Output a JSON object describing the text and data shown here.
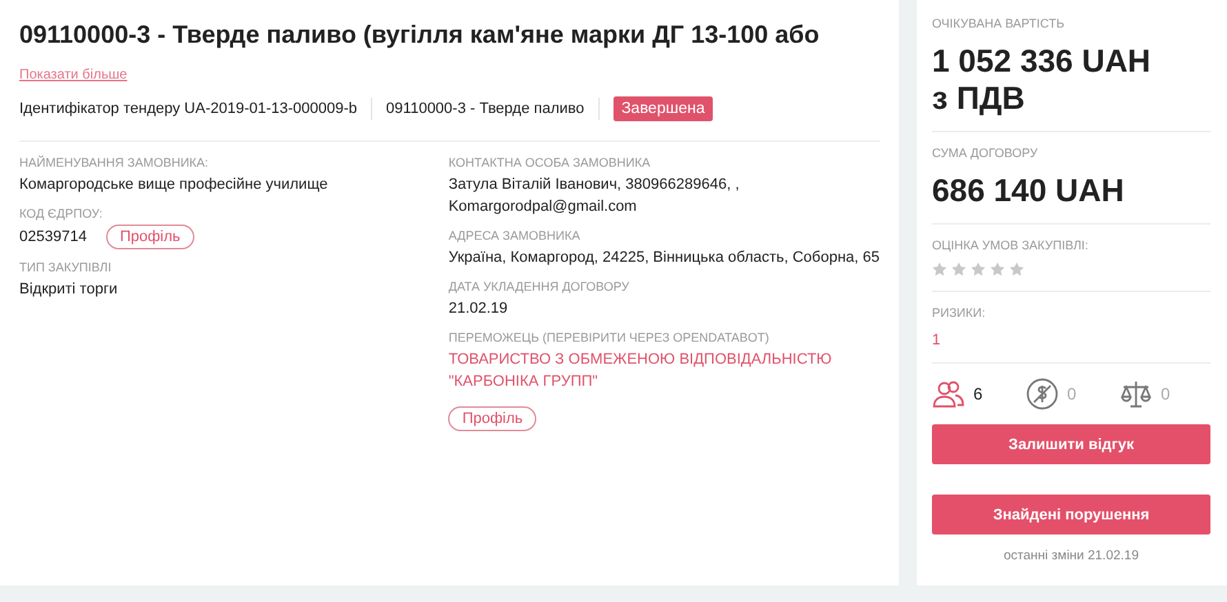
{
  "title": "09110000-3 - Тверде паливо (вугілля кам'яне марки ДГ 13-100 або",
  "show_more": "Показати більше",
  "meta": {
    "tender_id": "Ідентифікатор тендеру UA-2019-01-13-000009-b",
    "classification": "09110000-3 - Тверде паливо",
    "status": "Завершена"
  },
  "left_fields": [
    {
      "label": "НАЙМЕНУВАННЯ ЗАМОВНИКА:",
      "value": "Комаргородське вище професійне училище",
      "kind": "text"
    },
    {
      "label": "КОД ЄДРПОУ:",
      "value": "02539714",
      "kind": "profile",
      "button": "Профіль"
    },
    {
      "label": "ТИП ЗАКУПІВЛІ",
      "value": "Відкриті торги",
      "kind": "text"
    }
  ],
  "right_fields": [
    {
      "label": "КОНТАКТНА ОСОБА ЗАМОВНИКА",
      "lines": [
        "Затула Віталій Іванович, 380966289646, ,",
        "Komargorodpal@gmail.com"
      ],
      "kind": "text"
    },
    {
      "label": "АДРЕСА ЗАМОВНИКА",
      "lines": [
        "Україна, Комаргород, 24225, Вінницька область, Соборна, 65"
      ],
      "kind": "text"
    },
    {
      "label": "ДАТА УКЛАДЕННЯ ДОГОВОРУ",
      "lines": [
        "21.02.19"
      ],
      "kind": "text"
    },
    {
      "label": "ПЕРЕМОЖЕЦЬ (ПЕРЕВІРИТИ ЧЕРЕЗ OPENDATABOT)",
      "lines": [
        "ТОВАРИСТВО З ОБМЕЖЕНОЮ ВІДПОВІДАЛЬНІСТЮ",
        "\"КАРБОНІКА ГРУПП\""
      ],
      "kind": "link",
      "button": "Профіль"
    }
  ],
  "sidebar": {
    "expected_label": "ОЧІКУВАНА ВАРТІСТЬ",
    "expected_value": "1 052 336 UAH з ПДВ",
    "contract_label": "СУМА ДОГОВОРУ",
    "contract_value": "686 140 UAH",
    "rating_label": "ОЦІНКА УМОВ ЗАКУПІВЛІ:",
    "stars": 0,
    "risks_label": "РИЗИКИ:",
    "risks_value": "1",
    "stats": [
      {
        "kind": "people",
        "count": "6",
        "active": true
      },
      {
        "kind": "money",
        "count": "0",
        "active": false
      },
      {
        "kind": "scales",
        "count": "0",
        "active": false
      }
    ],
    "buttons": [
      "Залишити відгук",
      "Знайдені порушення"
    ],
    "last_change": "останні зміни 21.02.19"
  }
}
